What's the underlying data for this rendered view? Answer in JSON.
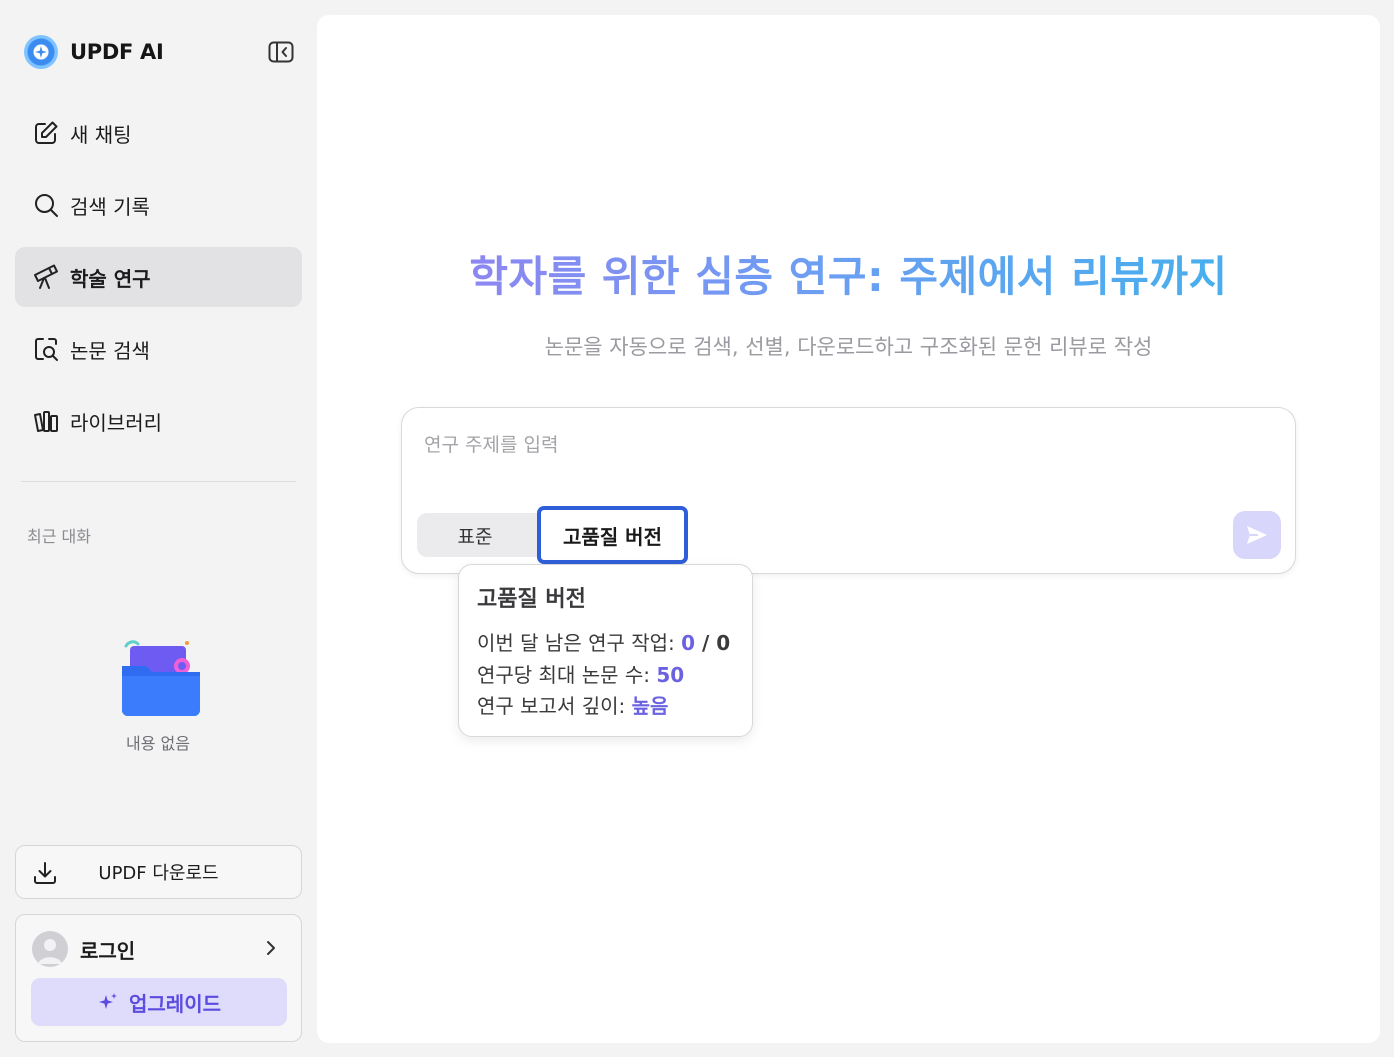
{
  "brand": {
    "title": "UPDF AI"
  },
  "sidebar": {
    "items": [
      {
        "label": "새 채팅",
        "icon": "edit-icon"
      },
      {
        "label": "검색 기록",
        "icon": "search-icon"
      },
      {
        "label": "학술 연구",
        "icon": "telescope-icon",
        "active": true
      },
      {
        "label": "논문 검색",
        "icon": "document-search-icon"
      },
      {
        "label": "라이브러리",
        "icon": "library-icon"
      }
    ],
    "recent_title": "최근 대화",
    "empty_label": "내용 없음",
    "download_label": "UPDF 다운로드",
    "login_label": "로그인",
    "upgrade_label": "업그레이드"
  },
  "main": {
    "title": "학자를 위한 심층 연구: 주제에서 리뷰까지",
    "subtitle": "논문을 자동으로 검색, 선별, 다운로드하고 구조화된 문헌 리뷰로 작성",
    "input": {
      "placeholder": "연구 주제를 입력",
      "value": ""
    },
    "modes": {
      "standard": "표준",
      "high_quality": "고품질 버전",
      "selected": "high_quality"
    }
  },
  "tooltip": {
    "title": "고품질 버전",
    "rows": [
      {
        "label": "이번 달 남은 연구 작업: ",
        "value_a": "0",
        "sep": " / ",
        "value_b": "0"
      },
      {
        "label": "연구당 최대 논문 수: ",
        "value": "50"
      },
      {
        "label": "연구 보고서 깊이: ",
        "value": "높음"
      }
    ]
  },
  "colors": {
    "accent": "#6a62e0",
    "focus_border": "#2f5fd8",
    "title_gradient_start": "#9b7cf0",
    "title_gradient_end": "#39b5ec"
  }
}
